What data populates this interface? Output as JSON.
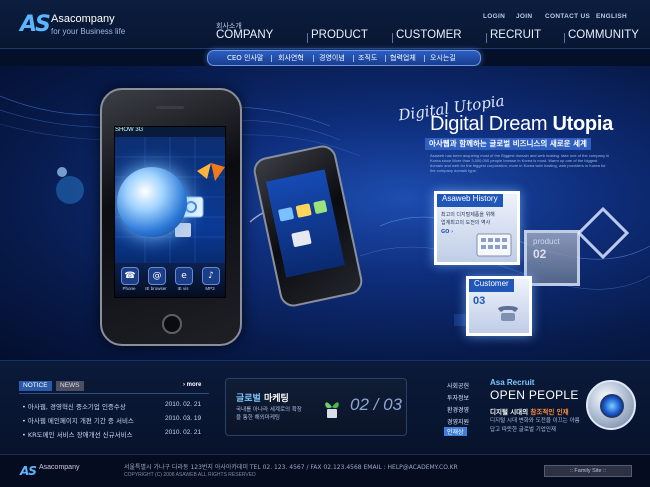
{
  "header": {
    "logo_mark": "AS",
    "logo_name": "Asacompany",
    "logo_tagline": "for your Business life",
    "util_links": [
      "LOGIN",
      "JOIN",
      "CONTACT US",
      "ENGLISH"
    ],
    "gnb": [
      {
        "label": "COMPANY",
        "ko": "회사소개"
      },
      {
        "label": "PRODUCT"
      },
      {
        "label": "CUSTOMER"
      },
      {
        "label": "RECRUIT"
      },
      {
        "label": "COMMUNITY"
      }
    ],
    "subnav": [
      "CEO 인사말",
      "회사연혁",
      "경영이념",
      "조직도",
      "협력업체",
      "오시는길"
    ]
  },
  "hero": {
    "script_text": "Digital Utopia",
    "title_pre": "Digital Dream ",
    "title_bold": "Utopia",
    "subtitle": "아사웹과 함께하는 글로벌 비즈니스의 새로운 세계",
    "desc": "Asaweb has been acquiring most of the Biggest domain and web hosting. take one of the company in Korea since More than 3,000,000 people browse in Korea is must. Warm up one of the biggest domain and web for the biggest corporation, more in Korea web hosting, web providers in Korea for the company domain type.",
    "phone": {
      "status": "SHOW  3G",
      "dock_labels": [
        "Phone",
        "IE browser",
        "IE vis",
        "MP3"
      ]
    },
    "cards": {
      "history": {
        "title": "Asaweb History",
        "body1": "최고의 디지털제품을 위해",
        "body2": "업계최고의 도전의 역사",
        "go": "GO ›"
      },
      "product": {
        "title": "product",
        "num": "02"
      },
      "customer": {
        "title": "Customer",
        "num": "03"
      }
    }
  },
  "notice": {
    "tab_active": "NOTICE",
    "tab_inactive": "NEWS",
    "more": "› more",
    "items": [
      {
        "text": "아사웹, 경영혁신 중소기업 인증수상",
        "date": "2010. 02. 21"
      },
      {
        "text": "아사웹 메인페이지 개편 기간 중 서비스",
        "date": "2010. 03. 19"
      },
      {
        "text": "KR도메인 서비스 장애개선 신규서비스",
        "date": "2010. 02. 21"
      }
    ]
  },
  "marketing": {
    "title_a": "글로벌",
    "title_b": " 마케팅",
    "desc": "국내를 아나라 세계로의 확장을 통한 해외마케팅",
    "nums": "02 / 03"
  },
  "recruit_menu": [
    "사회공헌",
    "투자정보",
    "환경경영",
    "경영지원",
    "인재상"
  ],
  "recruit": {
    "small": "Asa Recruit",
    "big": "OPEN PEOPLE",
    "headline_a": "디지털 시대의 ",
    "headline_b": "참조적인 인재",
    "desc": "디지털 시대 변화와 도전을 이끄는 아름답고 따뜻한 글로벌 기업인재"
  },
  "footer": {
    "logo_mark": "AS",
    "name": "Asacompany",
    "address": "서울특별시 가나구 다라동 123번지 아사아카데미 TEL 02. 123. 4567 / FAX 02.123.4568  EMAIL : HELP@ACADEMY.CO.KR",
    "copyright": "COPYRIGHT (C) 2008 ASAWEB ALL RIGHTS RESERVED",
    "family_site": ":: Family Site ::"
  },
  "colors": {
    "accent": "#2f5fc0",
    "highlight": "#7ec8ff",
    "recruit_orange": "#ff8a3a",
    "background": "#04102a"
  }
}
